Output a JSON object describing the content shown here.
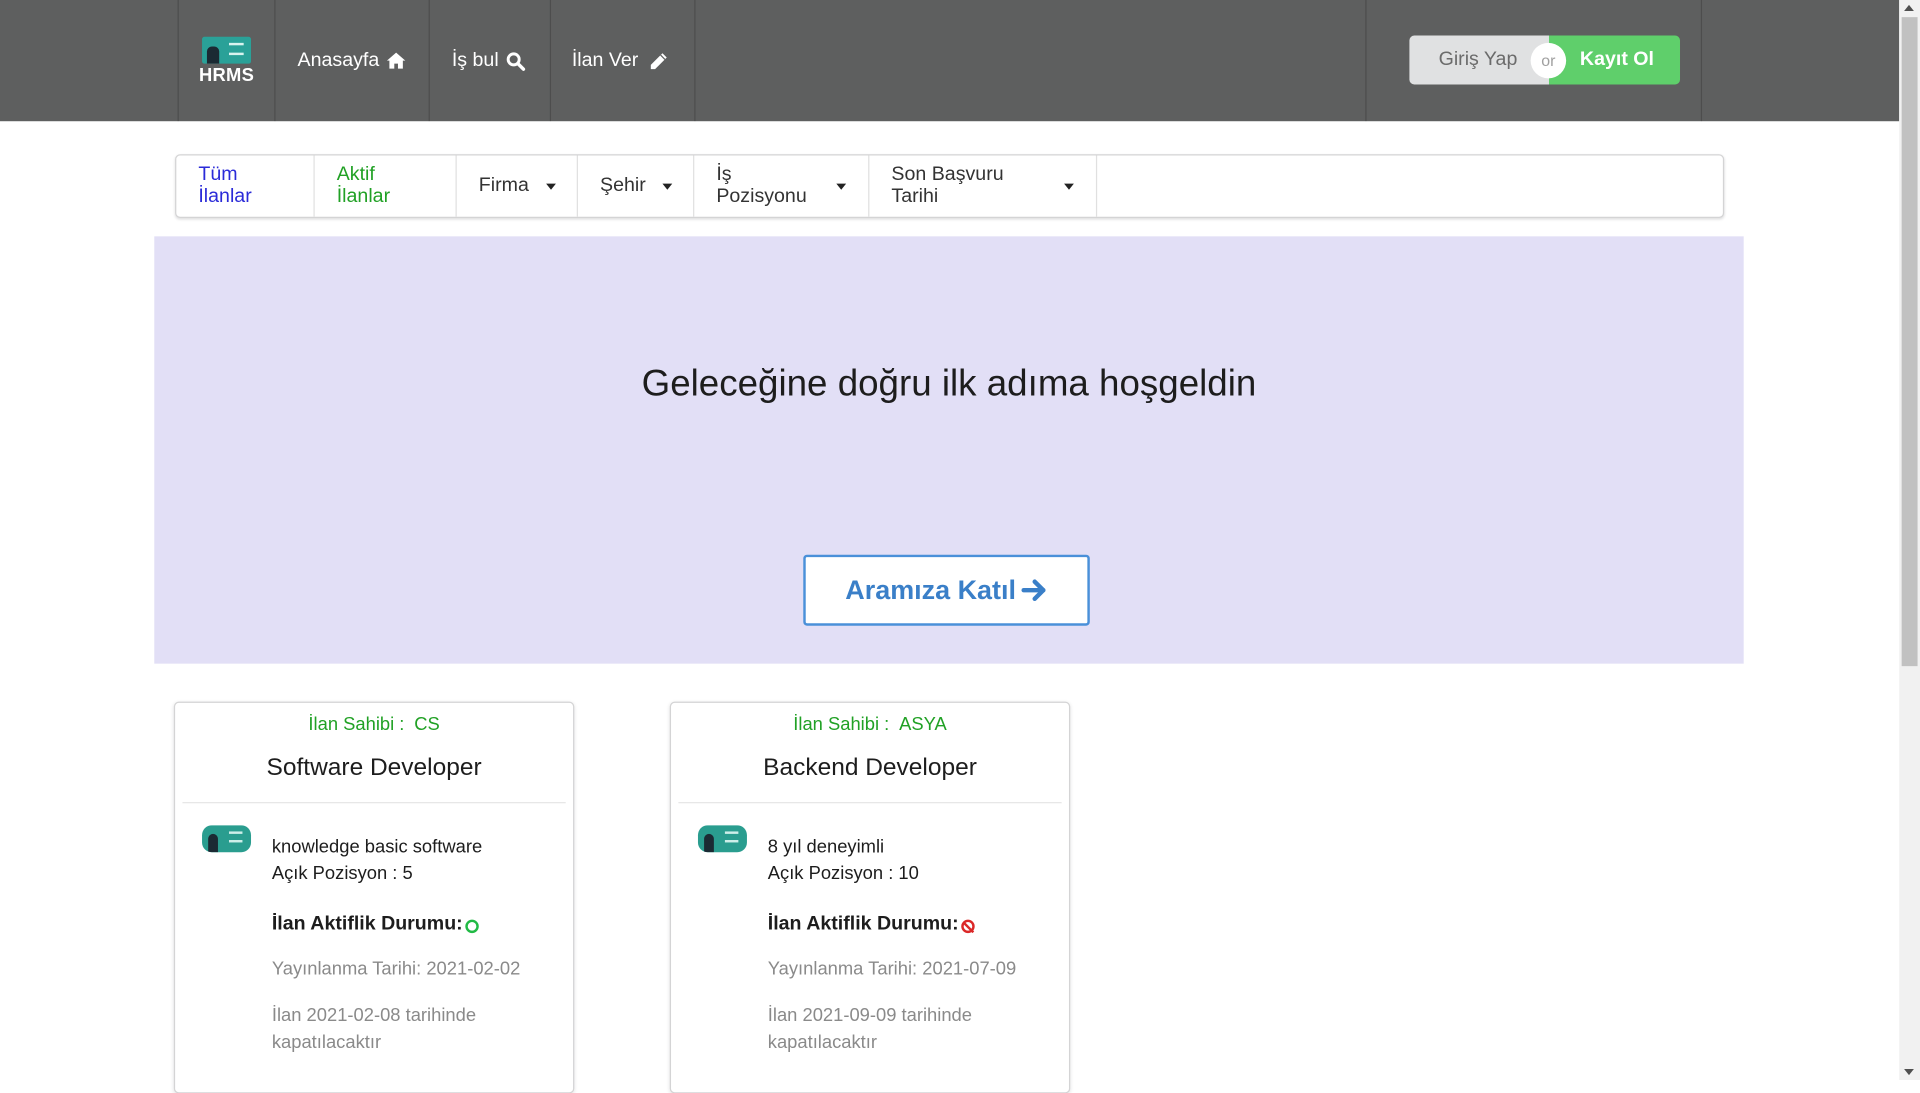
{
  "navbar": {
    "logo_text": "HRMS",
    "home_label": "Anasayfa",
    "home_icon": "home-icon",
    "find_job_label": "İş bul",
    "find_job_icon": "search-icon",
    "post_job_label": "İlan Ver",
    "post_job_icon": "pencil-icon",
    "login_label": "Giriş Yap",
    "or_label": "or",
    "register_label": "Kayıt Ol",
    "colors": {
      "background": "#5e5f5f",
      "register": "#5fcf6b",
      "login": "#e0e1e2"
    }
  },
  "filters": {
    "all_label": "Tüm İlanlar",
    "active_label": "Aktif İlanlar",
    "company_label": "Firma",
    "city_label": "Şehir",
    "position_label": "İş Pozisyonu",
    "deadline_label": "Son Başvuru Tarihi",
    "colors": {
      "all": "#2b2bd8",
      "active": "#21a125"
    }
  },
  "hero": {
    "title": "Geleceğine doğru ilk adıma hoşgeldin",
    "button_label": "Aramıza Katıl",
    "button_icon": "arrow-right-icon",
    "background": "#e2dff6"
  },
  "cards": [
    {
      "owner_label": "İlan Sahibi :",
      "owner": "CS",
      "title": "Software Developer",
      "description": "knowledge basic software",
      "open_positions": "Açık Pozisyon : 5",
      "status_label": "İlan Aktiflik Durumu:",
      "status": "active",
      "status_icon": "circle-outline-icon",
      "published": "Yayınlanma Tarihi: 2021-02-02",
      "closing": "İlan 2021-02-08 tarihinde kapatılacaktır"
    },
    {
      "owner_label": "İlan Sahibi :",
      "owner": "ASYA",
      "title": "Backend Developer",
      "description": "8 yıl deneyimli",
      "open_positions": "Açık Pozisyon : 10",
      "status_label": "İlan Aktiflik Durumu:",
      "status": "inactive",
      "status_icon": "ban-icon",
      "published": "Yayınlanma Tarihi: 2021-07-09",
      "closing": "İlan 2021-09-09 tarihinde kapatılacaktır"
    }
  ]
}
